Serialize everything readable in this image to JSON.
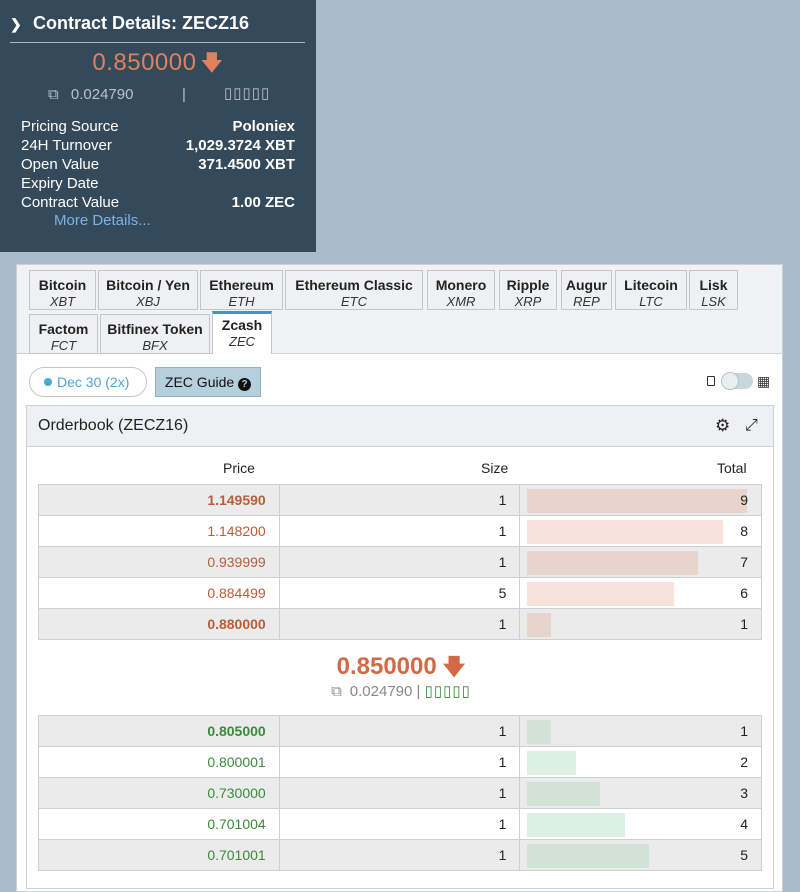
{
  "contract": {
    "title": "Contract Details: ZECZ16",
    "price": "0.850000",
    "sub_value": "0.024790",
    "separator": "|",
    "boxes": "▯▯▯▯▯",
    "rows": [
      {
        "label": "Pricing Source",
        "value": "Poloniex"
      },
      {
        "label": "24H Turnover",
        "value": "1,029.3724 XBT"
      },
      {
        "label": "Open Value",
        "value": "371.4500 XBT"
      },
      {
        "label": "Expiry Date",
        "value": ""
      },
      {
        "label": "Contract Value",
        "value": "1.00 ZEC"
      }
    ],
    "more_link": "More Details..."
  },
  "tabs": [
    {
      "name": "Bitcoin",
      "code": "XBT"
    },
    {
      "name": "Bitcoin / Yen",
      "code": "XBJ"
    },
    {
      "name": "Ethereum",
      "code": "ETH"
    },
    {
      "name": "Ethereum Classic",
      "code": "ETC"
    },
    {
      "name": "Monero",
      "code": "XMR"
    },
    {
      "name": "Ripple",
      "code": "XRP"
    },
    {
      "name": "Augur",
      "code": "REP"
    },
    {
      "name": "Litecoin",
      "code": "LTC"
    },
    {
      "name": "Lisk",
      "code": "LSK"
    },
    {
      "name": "Factom",
      "code": "FCT"
    },
    {
      "name": "Bitfinex Token",
      "code": "BFX"
    },
    {
      "name": "Zcash",
      "code": "ZEC",
      "active": true
    }
  ],
  "controls": {
    "contract_pill": "Dec 30 (2x)",
    "guide_button": "ZEC Guide"
  },
  "orderbook": {
    "title": "Orderbook (ZECZ16)",
    "columns": {
      "price": "Price",
      "size": "Size",
      "total": "Total"
    },
    "max_total": 9,
    "asks": [
      {
        "price": "1.149590",
        "size": "1",
        "total": 9
      },
      {
        "price": "1.148200",
        "size": "1",
        "total": 8
      },
      {
        "price": "0.939999",
        "size": "1",
        "total": 7
      },
      {
        "price": "0.884499",
        "size": "5",
        "total": 6
      },
      {
        "price": "0.880000",
        "size": "1",
        "total": 1
      }
    ],
    "mid_price": "0.850000",
    "mid_sub": "0.024790",
    "mid_separator": "|",
    "mid_boxes": "▯▯▯▯▯",
    "bids": [
      {
        "price": "0.805000",
        "size": "1",
        "total": 1
      },
      {
        "price": "0.800001",
        "size": "1",
        "total": 2
      },
      {
        "price": "0.730000",
        "size": "1",
        "total": 3
      },
      {
        "price": "0.701004",
        "size": "1",
        "total": 4
      },
      {
        "price": "0.701001",
        "size": "1",
        "total": 5
      }
    ],
    "colors": {
      "ask_bar_dark": "#e8d3cd",
      "ask_bar_light": "#f7e1d8",
      "bid_bar_dark": "#d3e2d7",
      "bid_bar_light": "#ddf1e3"
    }
  }
}
